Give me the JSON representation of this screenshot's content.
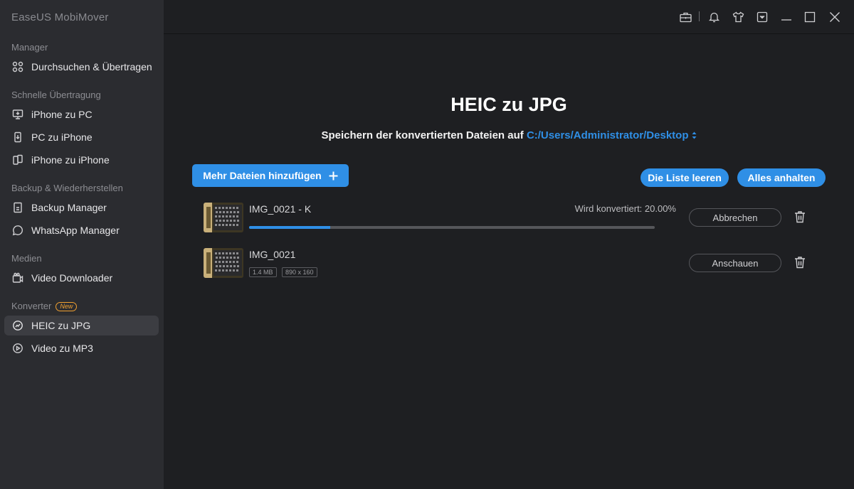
{
  "app": {
    "title": "EaseUS MobiMover"
  },
  "sidebar": {
    "sections": [
      {
        "label": "Manager"
      },
      {
        "label": "Schnelle Übertragung"
      },
      {
        "label": "Backup & Wiederherstellen"
      },
      {
        "label": "Medien"
      },
      {
        "label": "Konverter",
        "badge": "New"
      }
    ],
    "items": [
      {
        "label": "Durchsuchen & Übertragen",
        "icon": "grid-icon"
      },
      {
        "label": "iPhone zu PC",
        "icon": "monitor-icon"
      },
      {
        "label": "PC zu iPhone",
        "icon": "phone-in-icon"
      },
      {
        "label": "iPhone zu iPhone",
        "icon": "phone-transfer-icon"
      },
      {
        "label": "Backup Manager",
        "icon": "backup-icon"
      },
      {
        "label": "WhatsApp Manager",
        "icon": "whatsapp-icon"
      },
      {
        "label": "Video Downloader",
        "icon": "video-download-icon"
      },
      {
        "label": "HEIC zu JPG",
        "icon": "convert-image-icon",
        "active": true
      },
      {
        "label": "Video zu MP3",
        "icon": "convert-audio-icon"
      }
    ]
  },
  "main": {
    "title": "HEIC zu JPG",
    "save_prefix": "Speichern der konvertierten Dateien auf",
    "save_path": "C:/Users/Administrator/Desktop",
    "add_files": "Mehr Dateien hinzufügen",
    "clear_list": "Die Liste leeren",
    "pause_all": "Alles anhalten",
    "files": [
      {
        "name": "IMG_0021 - K",
        "status": "Wird konvertiert: 20.00%",
        "progress": 0.2,
        "action": "Abbrechen"
      },
      {
        "name": "IMG_0021",
        "size": "1.4 MB",
        "dimensions": "890 x 160",
        "action": "Anschauen"
      }
    ]
  },
  "colors": {
    "accent": "#2f8fe6",
    "badge": "#f0a030",
    "sidebar": "#2b2c30",
    "background": "#1e1f22"
  }
}
